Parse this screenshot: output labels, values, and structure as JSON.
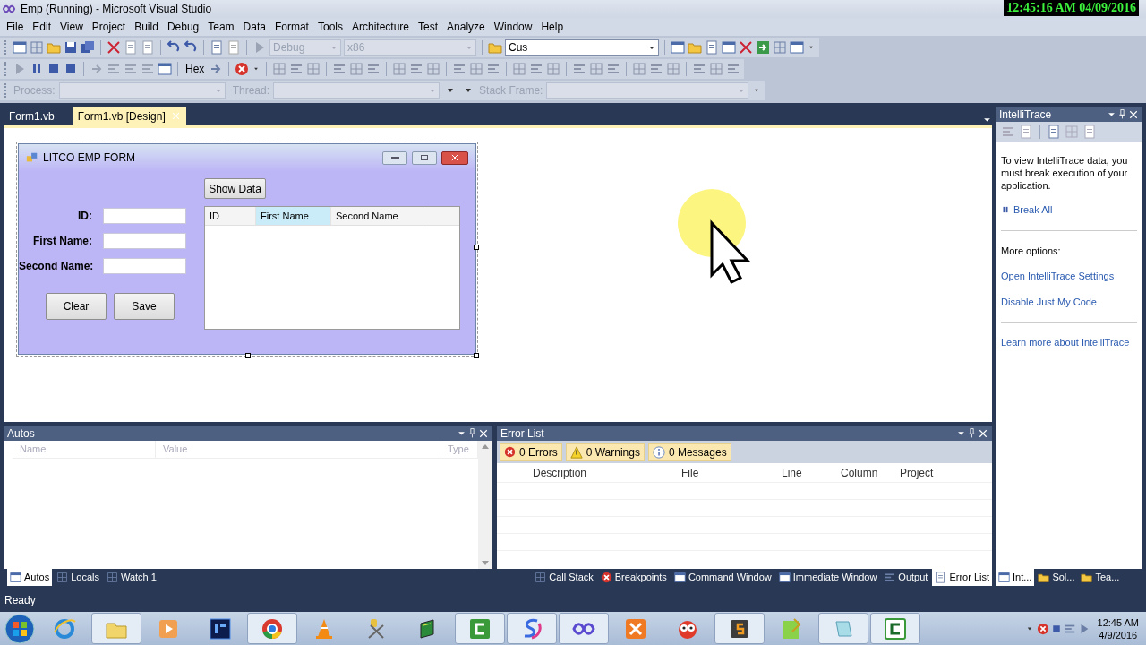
{
  "window": {
    "title": "Emp (Running) - Microsoft Visual Studio"
  },
  "clock_overlay": "12:45:16 AM 04/09/2016",
  "menu": [
    "File",
    "Edit",
    "View",
    "Project",
    "Build",
    "Debug",
    "Team",
    "Data",
    "Format",
    "Tools",
    "Architecture",
    "Test",
    "Analyze",
    "Window",
    "Help"
  ],
  "toolbar": {
    "configuration": "Debug",
    "platform": "x86",
    "find": "Cus",
    "hex_button": "Hex"
  },
  "debug_location": {
    "process_label": "Process:",
    "thread_label": "Thread:",
    "stack_frame_label": "Stack Frame:"
  },
  "document_tabs": [
    {
      "label": "Form1.vb",
      "selected": false
    },
    {
      "label": "Form1.vb [Design]",
      "selected": true
    }
  ],
  "form": {
    "title": "LITCO EMP FORM",
    "show_data_button": "Show Data",
    "fields": [
      {
        "label": "ID:"
      },
      {
        "label": "First Name:"
      },
      {
        "label": "Second Name:"
      }
    ],
    "buttons": [
      "Clear",
      "Save"
    ],
    "grid_columns": [
      {
        "label": "ID",
        "selected": false
      },
      {
        "label": "First Name",
        "selected": true
      },
      {
        "label": "Second Name",
        "selected": false
      }
    ]
  },
  "intellitrace": {
    "title": "IntelliTrace",
    "message": "To view IntelliTrace data, you must break execution of your application.",
    "break_all": "Break All",
    "more_options": "More options:",
    "links": [
      "Open IntelliTrace Settings",
      "Disable Just My Code"
    ],
    "learn_more": "Learn more about IntelliTrace"
  },
  "autos": {
    "title": "Autos",
    "columns": [
      "Name",
      "Value",
      "Type"
    ]
  },
  "debug_tabs": [
    {
      "label": "Autos",
      "selected": true
    },
    {
      "label": "Locals",
      "selected": false
    },
    {
      "label": "Watch 1",
      "selected": false
    }
  ],
  "error_list": {
    "title": "Error List",
    "filters": [
      {
        "kind": "error",
        "label": "0 Errors"
      },
      {
        "kind": "warning",
        "label": "0 Warnings"
      },
      {
        "kind": "message",
        "label": "0 Messages"
      }
    ],
    "columns": [
      "Description",
      "File",
      "Line",
      "Column",
      "Project"
    ]
  },
  "output_tabs": [
    {
      "label": "Call Stack",
      "selected": false
    },
    {
      "label": "Breakpoints",
      "selected": false
    },
    {
      "label": "Command Window",
      "selected": false
    },
    {
      "label": "Immediate Window",
      "selected": false
    },
    {
      "label": "Output",
      "selected": false
    },
    {
      "label": "Error List",
      "selected": true
    }
  ],
  "side_tabs": [
    {
      "label": "Int...",
      "selected": true
    },
    {
      "label": "Sol...",
      "selected": false
    },
    {
      "label": "Tea...",
      "selected": false
    }
  ],
  "status_bar": {
    "text": "Ready"
  },
  "taskbar": {
    "apps": [
      {
        "running": false
      },
      {
        "running": true
      },
      {
        "running": false
      },
      {
        "running": false
      },
      {
        "running": true
      },
      {
        "running": false
      },
      {
        "running": false
      },
      {
        "running": false
      },
      {
        "running": true
      },
      {
        "running": true
      },
      {
        "running": true
      },
      {
        "running": false
      },
      {
        "running": false
      },
      {
        "running": true
      },
      {
        "running": false
      },
      {
        "running": true
      },
      {
        "running": true
      }
    ],
    "clock": {
      "time": "12:45 AM",
      "date": "4/9/2016"
    }
  }
}
